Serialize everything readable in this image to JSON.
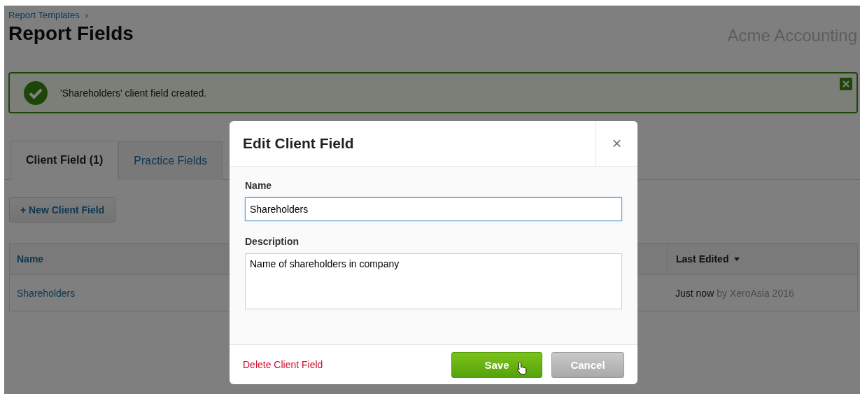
{
  "breadcrumb": {
    "link": "Report Templates",
    "separator": "›"
  },
  "title": "Report Fields",
  "organisation": "Acme Accounting",
  "alert": {
    "message": "'Shareholders' client field created."
  },
  "tabs": [
    {
      "label": "Client Field (1)",
      "selected": true
    },
    {
      "label": "Practice Fields",
      "selected": false
    }
  ],
  "new_button": "+ New Client Field",
  "table": {
    "columns": [
      {
        "label": "Name",
        "sorted": false
      },
      {
        "label": "Last Edited",
        "sorted": true
      }
    ],
    "rows": [
      {
        "name": "Shareholders",
        "edited": "Just now",
        "edited_by": "by XeroAsia 2016"
      }
    ]
  },
  "dialog": {
    "title": "Edit Client Field",
    "close": "×",
    "fields": [
      {
        "kind": "input",
        "label": "Name",
        "value": "Shareholders",
        "focused": true
      },
      {
        "kind": "textarea",
        "label": "Description",
        "value": "Name of shareholders in company",
        "focused": false
      }
    ],
    "delete_link": "Delete Client Field",
    "save": "Save",
    "cancel": "Cancel"
  }
}
